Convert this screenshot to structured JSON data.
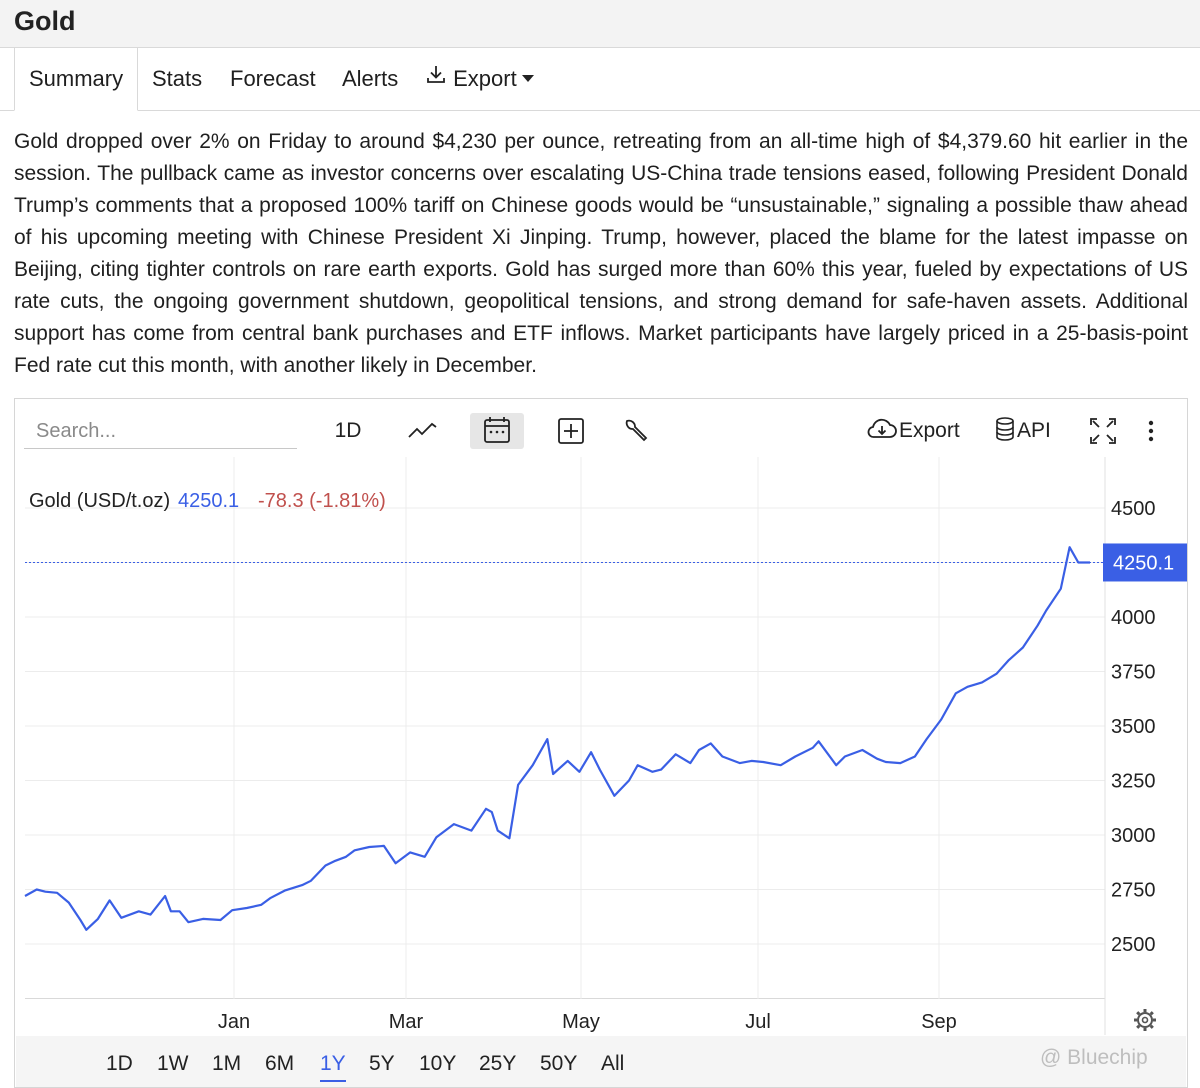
{
  "header": {
    "title": "Gold"
  },
  "tabs": [
    {
      "label": "Summary"
    },
    {
      "label": "Stats"
    },
    {
      "label": "Forecast"
    },
    {
      "label": "Alerts"
    },
    {
      "label": "Export"
    }
  ],
  "summary_text": "Gold dropped over 2% on Friday to around $4,230 per ounce, retreating from an all-time high of $4,379.60 hit earlier in the session. The pullback came as investor concerns over escalating US-China trade tensions eased, following President Donald Trump’s comments that a proposed 100% tariff on Chinese goods would be “unsustainable,” signaling a possible thaw ahead of his upcoming meeting with Chinese President Xi Jinping. Trump, however, placed the blame for the latest impasse on Beijing, citing tighter controls on rare earth exports. Gold has surged more than 60% this year, fueled by expectations of US rate cuts, the ongoing government shutdown, geopolitical tensions, and strong demand for safe-haven assets. Additional support has come from central bank purchases and ETF inflows. Market participants have largely priced in a 25-basis-point Fed rate cut this month, with another likely in December.",
  "toolbar": {
    "search_placeholder": "Search...",
    "interval_label": "1D",
    "export_label": "Export",
    "api_label": "API",
    "icons": [
      "line-chart-icon",
      "calendar-icon",
      "add-compare-icon",
      "wrench-icon",
      "cloud-download-icon",
      "database-icon",
      "fullscreen-icon",
      "more-vertical-icon"
    ]
  },
  "legend": {
    "name": "Gold (USD/t.oz)",
    "price": "4250.1",
    "change": "-78.3 (-1.81%)"
  },
  "colors": {
    "line": "#3a5fe5",
    "change_negative": "#c0504d",
    "accent": "#3a5fe5"
  },
  "chart_data": {
    "type": "line",
    "title": "",
    "xlabel": "",
    "ylabel": "",
    "ylim": [
      2250,
      4600
    ],
    "yticks": [
      2500,
      2750,
      3000,
      3250,
      3500,
      3750,
      4000,
      4500
    ],
    "xtick_labels": [
      "Jan",
      "Mar",
      "May",
      "Jul",
      "Sep"
    ],
    "x_range": [
      "2024-10-24",
      "2025-10-24"
    ],
    "last_price_label": "4250.1",
    "last_price": 4250.1,
    "grid": true,
    "series": [
      {
        "x": [
          "2024-10-24",
          "2024-10-28",
          "2024-10-31",
          "2024-11-04",
          "2024-11-08",
          "2024-11-12",
          "2024-11-14",
          "2024-11-18",
          "2024-11-22",
          "2024-11-26",
          "2024-12-02",
          "2024-12-06",
          "2024-12-11",
          "2024-12-13",
          "2024-12-16",
          "2024-12-19",
          "2024-12-24",
          "2024-12-30",
          "2025-01-03",
          "2025-01-08",
          "2025-01-13",
          "2025-01-16",
          "2025-01-21",
          "2025-01-27",
          "2025-01-30",
          "2025-02-04",
          "2025-02-07",
          "2025-02-11",
          "2025-02-14",
          "2025-02-19",
          "2025-02-24",
          "2025-02-28",
          "2025-03-05",
          "2025-03-10",
          "2025-03-14",
          "2025-03-20",
          "2025-03-26",
          "2025-03-31",
          "2025-04-02",
          "2025-04-04",
          "2025-04-08",
          "2025-04-11",
          "2025-04-16",
          "2025-04-21",
          "2025-04-23",
          "2025-04-28",
          "2025-05-02",
          "2025-05-06",
          "2025-05-09",
          "2025-05-14",
          "2025-05-19",
          "2025-05-22",
          "2025-05-27",
          "2025-05-30",
          "2025-06-04",
          "2025-06-09",
          "2025-06-12",
          "2025-06-16",
          "2025-06-20",
          "2025-06-26",
          "2025-06-30",
          "2025-07-04",
          "2025-07-10",
          "2025-07-15",
          "2025-07-21",
          "2025-07-23",
          "2025-07-29",
          "2025-08-01",
          "2025-08-07",
          "2025-08-12",
          "2025-08-15",
          "2025-08-20",
          "2025-08-25",
          "2025-08-29",
          "2025-09-03",
          "2025-09-08",
          "2025-09-12",
          "2025-09-17",
          "2025-09-22",
          "2025-09-26",
          "2025-10-01",
          "2025-10-06",
          "2025-10-09",
          "2025-10-14",
          "2025-10-17",
          "2025-10-20",
          "2025-10-24"
        ],
        "values": [
          2720,
          2750,
          2740,
          2735,
          2690,
          2610,
          2565,
          2615,
          2700,
          2620,
          2650,
          2635,
          2720,
          2650,
          2650,
          2600,
          2615,
          2610,
          2655,
          2665,
          2680,
          2710,
          2745,
          2770,
          2790,
          2860,
          2880,
          2900,
          2930,
          2945,
          2950,
          2870,
          2920,
          2900,
          2990,
          3050,
          3020,
          3120,
          3105,
          3020,
          2985,
          3230,
          3320,
          3440,
          3280,
          3340,
          3290,
          3380,
          3300,
          3180,
          3250,
          3320,
          3290,
          3300,
          3370,
          3330,
          3390,
          3420,
          3360,
          3330,
          3340,
          3335,
          3320,
          3360,
          3400,
          3430,
          3320,
          3360,
          3390,
          3350,
          3335,
          3330,
          3360,
          3440,
          3530,
          3650,
          3680,
          3700,
          3740,
          3800,
          3860,
          3960,
          4030,
          4130,
          4320,
          4250,
          4250.1
        ]
      }
    ]
  },
  "range_buttons": [
    "1D",
    "1W",
    "1M",
    "6M",
    "1Y",
    "5Y",
    "10Y",
    "25Y",
    "50Y",
    "All"
  ],
  "active_range": "1Y",
  "watermark": "@ Bluechip"
}
